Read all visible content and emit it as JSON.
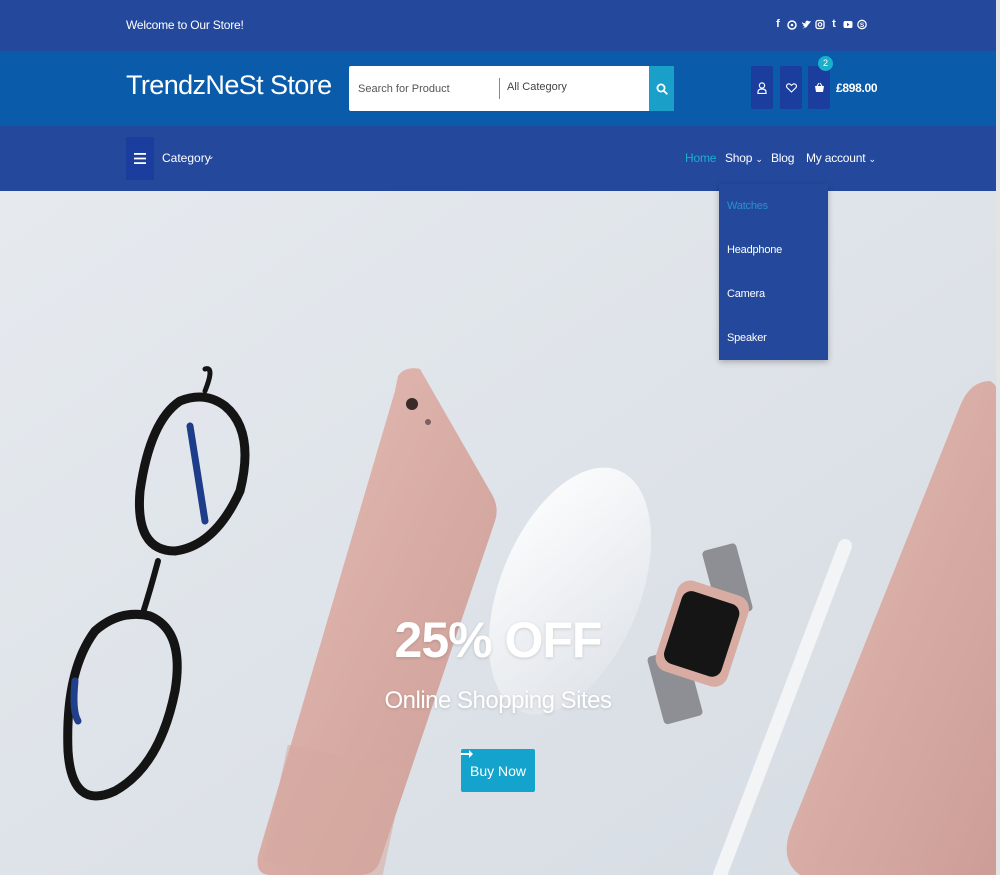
{
  "topbar": {
    "welcome": "Welcome to Our Store!",
    "social": [
      "facebook-icon",
      "pinterest-icon",
      "twitter-icon",
      "instagram-icon",
      "tumblr-icon",
      "youtube-icon",
      "skype-icon"
    ]
  },
  "header": {
    "logo": "TrendzNeSt Store",
    "search_placeholder": "Search for Product",
    "search_category": "All Category",
    "cart_count": "2",
    "cart_total": "£898.00"
  },
  "nav": {
    "category_label": "Category",
    "items": [
      {
        "label": "Home",
        "active": true
      },
      {
        "label": "Shop",
        "has_dropdown": true
      },
      {
        "label": "Blog"
      },
      {
        "label": "My account",
        "has_dropdown": true
      }
    ],
    "shop_dropdown": [
      {
        "label": "Watches",
        "active": true
      },
      {
        "label": "Headphone"
      },
      {
        "label": "Camera"
      },
      {
        "label": "Speaker"
      }
    ]
  },
  "hero": {
    "headline": "25% OFF",
    "subheadline": "Online Shopping Sites",
    "button_label": "Buy Now",
    "button_icon": "arrow-right-icon"
  },
  "colors": {
    "topbar": "#24499c",
    "header": "#0a5caa",
    "accent": "#1ab0cc",
    "hero_bg": "#dfe4ea"
  }
}
